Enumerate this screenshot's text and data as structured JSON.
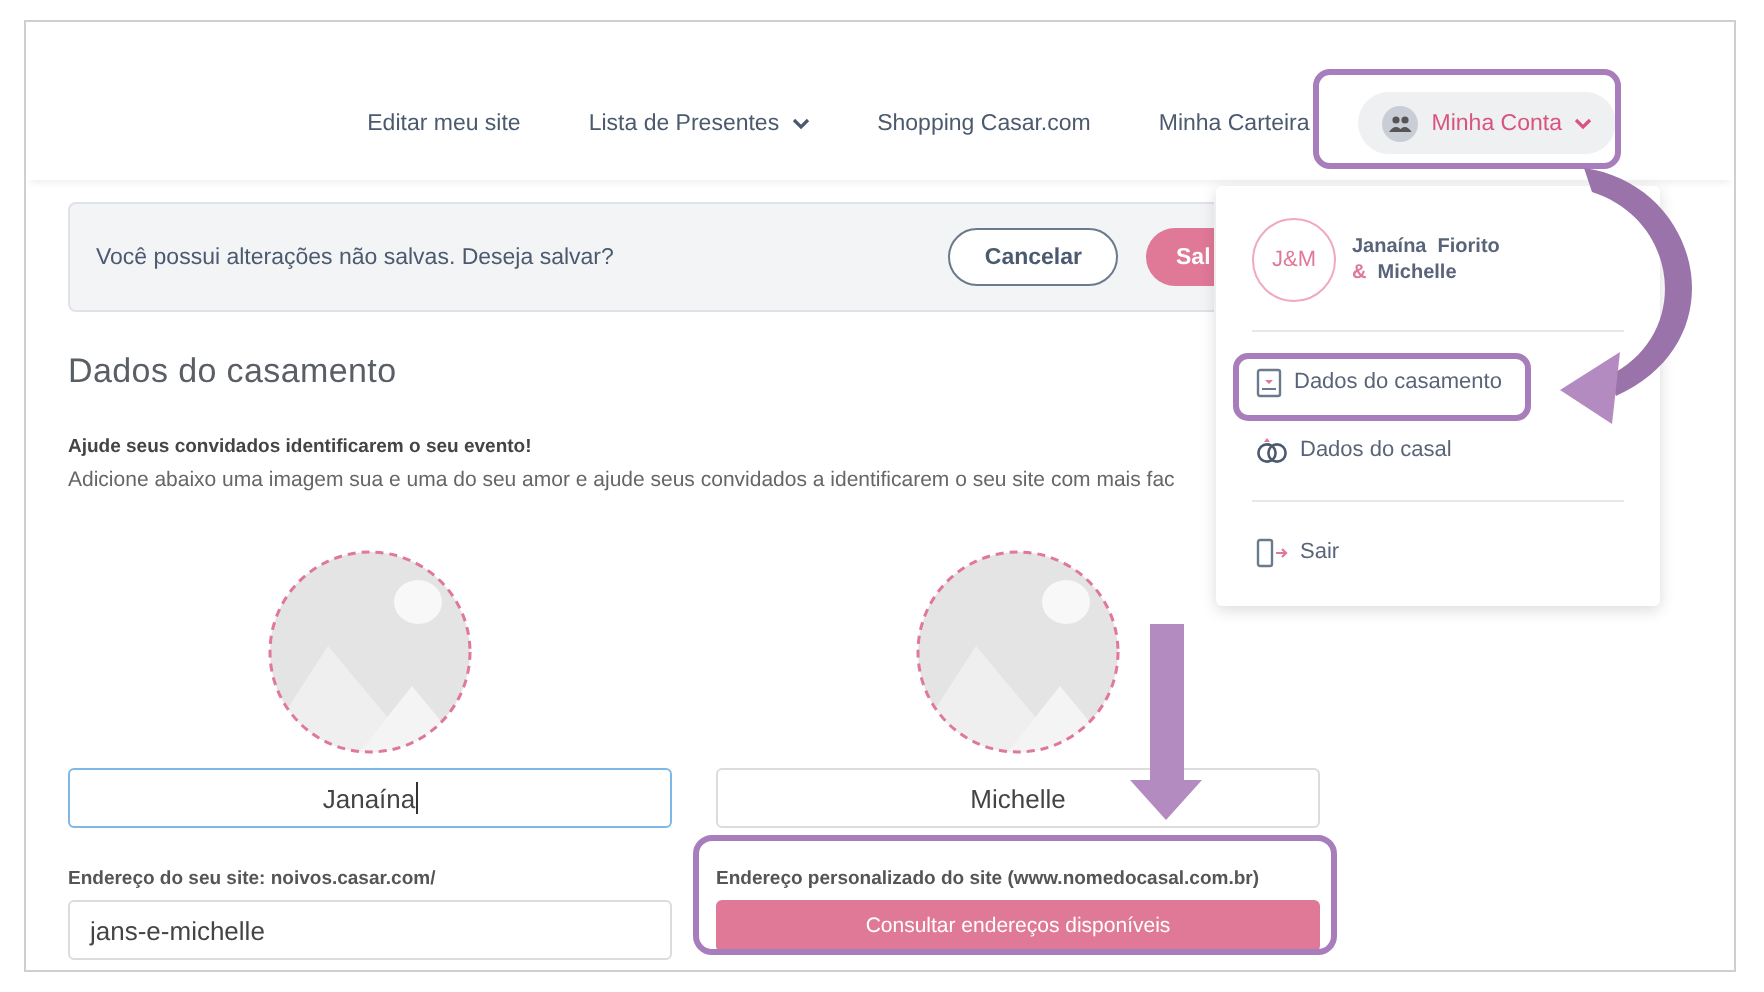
{
  "nav": {
    "links": [
      {
        "label": "Editar meu site",
        "kind": "link"
      },
      {
        "label": "Lista de Presentes",
        "kind": "dropdown"
      },
      {
        "label": "Shopping Casar.com",
        "kind": "link"
      },
      {
        "label": "Minha Carteira",
        "kind": "link"
      }
    ],
    "account": {
      "label": "Minha Conta",
      "expanded": true
    }
  },
  "notice": {
    "message": "Você possui alterações não salvas. Deseja salvar?",
    "buttons": [
      {
        "label": "Cancelar",
        "kind": "secondary"
      },
      {
        "label": "Sal",
        "kind": "primary"
      }
    ]
  },
  "form": {
    "title": "Dados do casamento",
    "lead": "Ajude seus convidados identificarem o seu evento!",
    "description": "Adicione abaixo uma imagem sua e uma do seu amor e ajude seus convidados a identificarem o seu site com mais fac",
    "partners": [
      {
        "value": "Janaína",
        "focused": true
      },
      {
        "value": "Michelle",
        "focused": false
      }
    ],
    "site_address": {
      "label": "Endereço do seu site: noivos.casar.com/",
      "value": "jans-e-michelle"
    },
    "custom_address": {
      "label": "Endereço personalizado do site (www.nomedocasal.com.br)",
      "button": "Consultar endereços disponíveis"
    }
  },
  "account_menu": {
    "initials": "J&M",
    "name_first": "Janaína  Fiorito",
    "name_joiner": "&",
    "name_second": "Michelle",
    "items": [
      {
        "label": "Dados do casamento"
      },
      {
        "label": "Dados do casal"
      }
    ],
    "logout": "Sair"
  },
  "annotations": [
    {
      "kind": "account_highlight"
    },
    {
      "kind": "menu_item_highlight"
    },
    {
      "kind": "address_highlight"
    },
    {
      "kind": "curved_arrow"
    },
    {
      "kind": "down_arrow"
    }
  ]
}
